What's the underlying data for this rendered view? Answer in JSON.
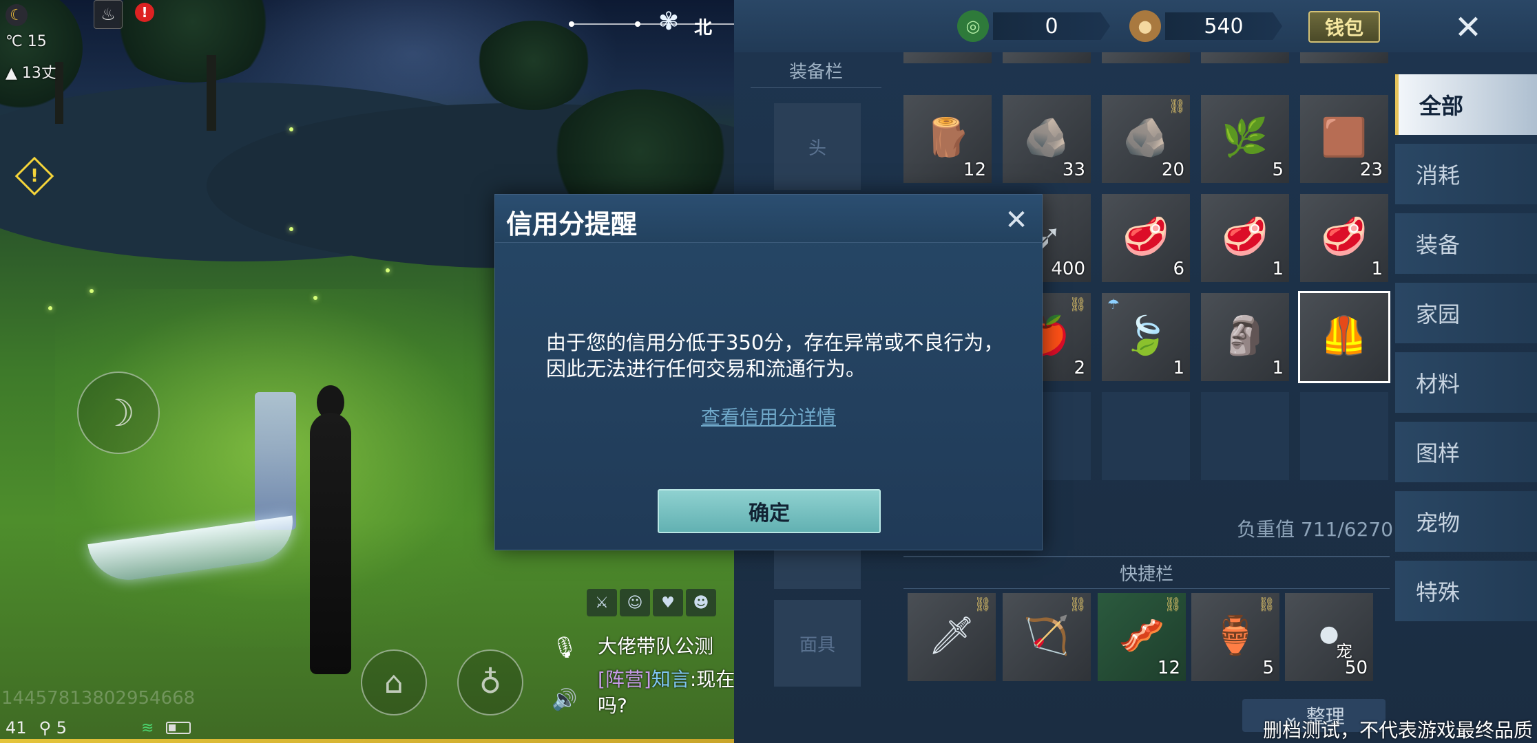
{
  "hud": {
    "temperature": "℃ 15",
    "altitude": "13丈",
    "compass_dir": "北",
    "player_id": "14457813802954668",
    "status_num": "41",
    "signal_num": "5"
  },
  "chat": {
    "channel_line": "大佬带队公测",
    "msg_tag": "[阵营]",
    "msg_user": "知言",
    "msg_text": ":现在",
    "msg_line2": "吗?"
  },
  "currency": {
    "jade_value": "0",
    "coin_value": "540",
    "wallet_label": "钱包"
  },
  "equip": {
    "title": "装备栏",
    "slot_head": "头",
    "slot_mask": "面具"
  },
  "inventory": {
    "items": [
      {
        "name": "wood-sticks",
        "icon": "🪵",
        "count": "12"
      },
      {
        "name": "gold-ore",
        "icon": "🪨",
        "count": "33"
      },
      {
        "name": "gold-ore-bound",
        "icon": "🪨",
        "count": "20"
      },
      {
        "name": "herb",
        "icon": "🌿",
        "count": "5"
      },
      {
        "name": "hide",
        "icon": "🟫",
        "count": "23"
      },
      {
        "name": "arrows",
        "icon": "➶",
        "count": "400"
      },
      {
        "name": "raw-meat",
        "icon": "🥩",
        "count": "6"
      },
      {
        "name": "raw-meat-2",
        "icon": "🥩",
        "count": "1"
      },
      {
        "name": "raw-meat-3",
        "icon": "🥩",
        "count": "1"
      },
      {
        "name": "apple",
        "icon": "🍎",
        "count": "2"
      },
      {
        "name": "leaf-bowl",
        "icon": "🍃",
        "count": "1"
      },
      {
        "name": "statue",
        "icon": "🗿",
        "count": "1"
      },
      {
        "name": "vest",
        "icon": "🦺",
        "count": ""
      }
    ],
    "weight": "负重值 711/6270"
  },
  "categories": [
    "全部",
    "消耗",
    "装备",
    "家园",
    "材料",
    "图样",
    "宠物",
    "特殊"
  ],
  "quickbar": {
    "title": "快捷栏",
    "items": [
      {
        "name": "sword",
        "icon": "🗡",
        "count": ""
      },
      {
        "name": "crossbow",
        "icon": "🏹",
        "count": ""
      },
      {
        "name": "meat",
        "icon": "🥓",
        "count": "12"
      },
      {
        "name": "vase",
        "icon": "🏺",
        "count": "5"
      },
      {
        "name": "balls",
        "icon": "⚫",
        "count": "50",
        "tag": "宠"
      }
    ],
    "sort_label": "整理"
  },
  "footnote": "删档测试，不代表游戏最终品质",
  "modal": {
    "title": "信用分提醒",
    "message": "由于您的信用分低于350分，存在异常或不良行为，因此无法进行任何交易和流通行为。",
    "link": "查看信用分详情",
    "confirm": "确定"
  }
}
